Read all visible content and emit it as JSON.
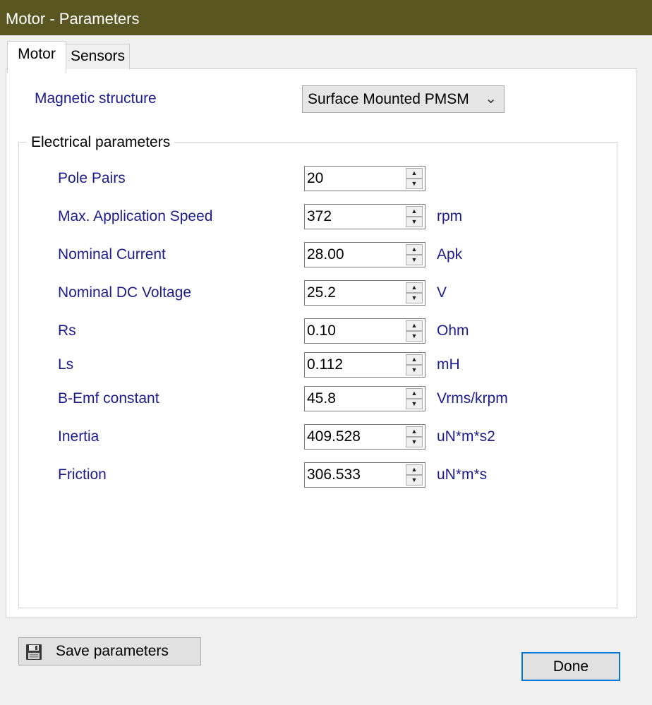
{
  "window": {
    "title": "Motor - Parameters"
  },
  "tabs": [
    {
      "label": "Motor",
      "active": true
    },
    {
      "label": "Sensors",
      "active": false
    }
  ],
  "magnetic_structure": {
    "label": "Magnetic structure",
    "selected": "Surface Mounted PMSM"
  },
  "electrical": {
    "group_title": "Electrical parameters",
    "params": [
      {
        "label": "Pole Pairs",
        "value": "20",
        "unit": ""
      },
      {
        "label": "Max. Application Speed",
        "value": "372",
        "unit": "rpm"
      },
      {
        "label": "Nominal Current",
        "value": "28.00",
        "unit": "Apk"
      },
      {
        "label": "Nominal DC Voltage",
        "value": "25.2",
        "unit": "V"
      },
      {
        "label": "Rs",
        "value": "0.10",
        "unit": "Ohm"
      },
      {
        "label": "Ls",
        "value": "0.112",
        "unit": "mH"
      },
      {
        "label": "B-Emf constant",
        "value": "45.8",
        "unit": "Vrms/krpm"
      },
      {
        "label": "Inertia",
        "value": "409.528",
        "unit": "uN*m*s2"
      },
      {
        "label": "Friction",
        "value": "306.533",
        "unit": "uN*m*s"
      }
    ]
  },
  "buttons": {
    "save_label": "Save parameters",
    "done_label": "Done"
  },
  "colors": {
    "titlebar": "#5a5622",
    "label_blue": "#1c1c8e",
    "focus_border": "#0078d7"
  }
}
